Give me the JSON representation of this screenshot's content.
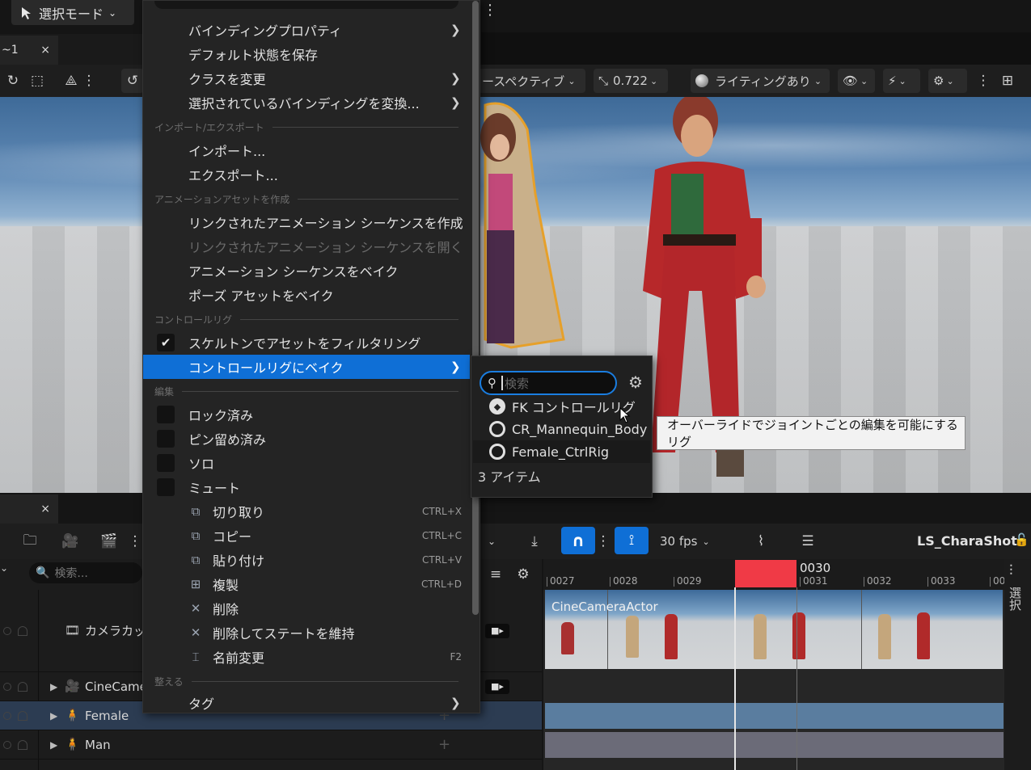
{
  "top_bar": {
    "mode_label": "選択モード"
  },
  "viewport_tab": {
    "title": "~1",
    "close": "×"
  },
  "viewport_toolbar": {
    "perspective_label": "ースペクティブ",
    "fov_value": "0.722",
    "lighting_label": "ライティングあり"
  },
  "context_menu": {
    "items_top": [
      {
        "label": "バインディングプロパティ",
        "submenu": true
      },
      {
        "label": "デフォルト状態を保存",
        "submenu": false
      },
      {
        "label": "クラスを変更",
        "submenu": true
      },
      {
        "label": "選択されているバインディングを変換...",
        "submenu": true
      }
    ],
    "section_import": "インポート/エクスポート",
    "items_import": [
      {
        "label": "インポート..."
      },
      {
        "label": "エクスポート..."
      }
    ],
    "section_anim": "アニメーションアセットを作成",
    "items_anim": [
      {
        "label": "リンクされたアニメーション シーケンスを作成",
        "disabled": false
      },
      {
        "label": "リンクされたアニメーション シーケンスを開く",
        "disabled": true
      },
      {
        "label": "アニメーション シーケンスをベイク",
        "disabled": false
      },
      {
        "label": "ポーズ アセットをベイク",
        "disabled": false
      }
    ],
    "section_rig": "コントロールリグ",
    "filter_by_skeleton": {
      "label": "スケルトンでアセットをフィルタリング",
      "checked": true
    },
    "bake_to_rig": {
      "label": "コントロールリグにベイク",
      "highlighted": true
    },
    "section_edit": "編集",
    "toggles": [
      {
        "label": "ロック済み",
        "checked": false
      },
      {
        "label": "ピン留め済み",
        "checked": false
      },
      {
        "label": "ソロ",
        "checked": false
      },
      {
        "label": "ミュート",
        "checked": false
      }
    ],
    "edit_items": [
      {
        "label": "切り取り",
        "shortcut": "CTRL+X",
        "icon": "cut-icon"
      },
      {
        "label": "コピー",
        "shortcut": "CTRL+C",
        "icon": "copy-icon"
      },
      {
        "label": "貼り付け",
        "shortcut": "CTRL+V",
        "icon": "paste-icon"
      },
      {
        "label": "複製",
        "shortcut": "CTRL+D",
        "icon": "duplicate-icon"
      },
      {
        "label": "削除",
        "shortcut": "",
        "icon": "delete-icon"
      },
      {
        "label": "削除してステートを維持",
        "shortcut": "",
        "icon": "delete-keep-state-icon"
      },
      {
        "label": "名前変更",
        "shortcut": "F2",
        "icon": "rename-icon"
      }
    ],
    "section_organize": "整える",
    "tag_item": "タグ"
  },
  "submenu": {
    "search_placeholder": "検索",
    "items": [
      {
        "label": "FK コントロールリグ",
        "icon": "fk-rig-icon"
      },
      {
        "label": "CR_Mannequin_Body",
        "icon": "rig-asset-icon"
      },
      {
        "label": "Female_CtrlRig",
        "icon": "rig-asset-icon"
      }
    ],
    "count": "3 アイテム"
  },
  "tooltip": "オーバーライドでジョイントごとの編集を可能にするリグ",
  "sequencer": {
    "tab_close": "×",
    "fps": "30 fps",
    "sequence_name": "LS_CharaShot",
    "search_placeholder": "検索...",
    "side_tab_label": "選択",
    "current_frame": "0030",
    "ruler_ticks": [
      "0027",
      "0028",
      "0029",
      "0031",
      "0032",
      "0033",
      "00"
    ],
    "tracks": [
      {
        "label": "カメラカット",
        "icon": "camera-cut-icon"
      },
      {
        "label": "CineCame",
        "icon": "cine-camera-icon"
      },
      {
        "label": "Female",
        "icon": "skeletal-mesh-icon"
      },
      {
        "label": "Man",
        "icon": "skeletal-mesh-icon"
      }
    ],
    "camera_section_label": "CineCameraActor"
  },
  "colors": {
    "accent": "#0f6fd6",
    "playhead": "#f03a46",
    "female_bar": "#5a7d9f",
    "man_bar": "#6b6b78"
  }
}
